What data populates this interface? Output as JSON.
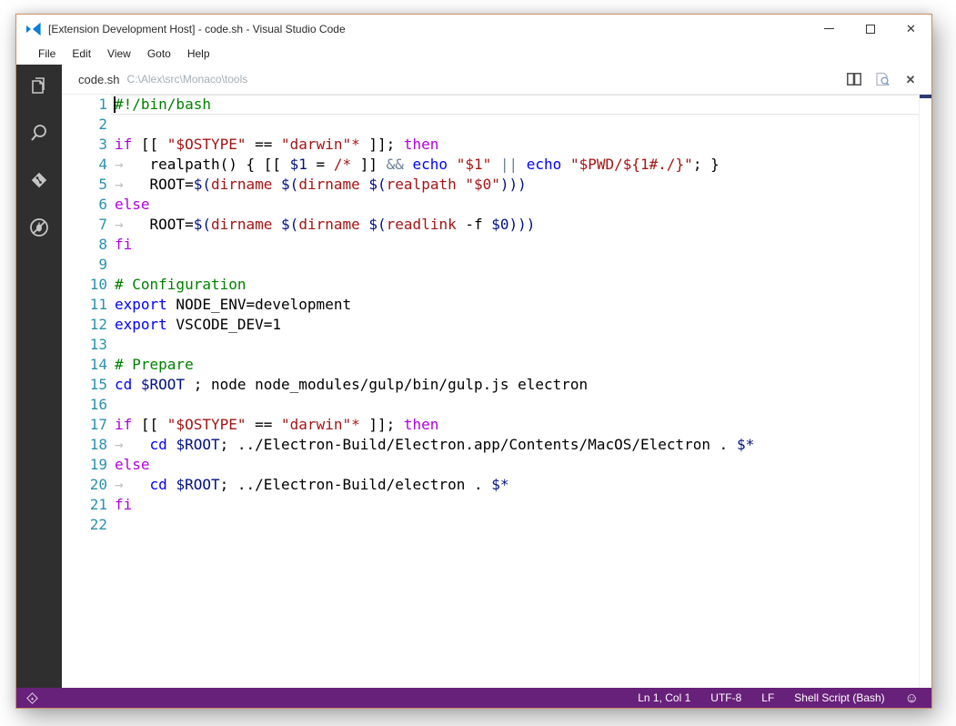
{
  "window": {
    "title": "[Extension Development Host] - code.sh - Visual Studio Code",
    "border_color": "#cb8f63",
    "controls": {
      "minimize": "minimize",
      "maximize": "maximize",
      "close": "close"
    }
  },
  "menu_bar": {
    "items": [
      {
        "label": "File",
        "name": "menu-item-file"
      },
      {
        "label": "Edit",
        "name": "menu-item-edit"
      },
      {
        "label": "View",
        "name": "menu-item-view"
      },
      {
        "label": "Goto",
        "name": "menu-item-goto"
      },
      {
        "label": "Help",
        "name": "menu-item-help"
      }
    ]
  },
  "activity_bar": {
    "icons": [
      "explorer",
      "search",
      "git",
      "debug"
    ],
    "background": "#2f2f2f"
  },
  "tab_bar": {
    "file_name": "code.sh",
    "file_path": "C:\\Alex\\src\\Monaco\\tools",
    "actions": [
      "split-editor",
      "preview",
      "close-tab"
    ]
  },
  "editor": {
    "cursor": {
      "line": 1,
      "col": 1
    },
    "token_colors": {
      "pl": "#000000",
      "kw": "#af00db",
      "bi": "#0000ff",
      "str": "#a31515",
      "fn": "#a31515",
      "var": "#001080",
      "op": "#6b8299",
      "cm": "#008000",
      "ws": "#c0c0c0"
    },
    "lines": [
      [
        {
          "t": "#!/bin/bash",
          "c": "cm"
        }
      ],
      [],
      [
        {
          "t": "if",
          "c": "kw"
        },
        {
          "t": " [[ ",
          "c": "pl"
        },
        {
          "t": "\"$OSTYPE\"",
          "c": "str"
        },
        {
          "t": " == ",
          "c": "pl"
        },
        {
          "t": "\"darwin\"*",
          "c": "str"
        },
        {
          "t": " ]]; ",
          "c": "pl"
        },
        {
          "t": "then",
          "c": "kw"
        }
      ],
      [
        {
          "t": "→   ",
          "c": "ws"
        },
        {
          "t": "realpath() { [[ ",
          "c": "pl"
        },
        {
          "t": "$1",
          "c": "var"
        },
        {
          "t": " = ",
          "c": "pl"
        },
        {
          "t": "/*",
          "c": "str"
        },
        {
          "t": " ]] ",
          "c": "pl"
        },
        {
          "t": "&&",
          "c": "op"
        },
        {
          "t": " ",
          "c": "pl"
        },
        {
          "t": "echo",
          "c": "bi"
        },
        {
          "t": " ",
          "c": "pl"
        },
        {
          "t": "\"$1\"",
          "c": "str"
        },
        {
          "t": " ",
          "c": "pl"
        },
        {
          "t": "||",
          "c": "op"
        },
        {
          "t": " ",
          "c": "pl"
        },
        {
          "t": "echo",
          "c": "bi"
        },
        {
          "t": " ",
          "c": "pl"
        },
        {
          "t": "\"$PWD/${1#./}\"",
          "c": "str"
        },
        {
          "t": "; }",
          "c": "pl"
        }
      ],
      [
        {
          "t": "→   ",
          "c": "ws"
        },
        {
          "t": "ROOT=",
          "c": "pl"
        },
        {
          "t": "$(",
          "c": "var"
        },
        {
          "t": "dirname",
          "c": "fn"
        },
        {
          "t": " ",
          "c": "pl"
        },
        {
          "t": "$(",
          "c": "var"
        },
        {
          "t": "dirname",
          "c": "fn"
        },
        {
          "t": " ",
          "c": "pl"
        },
        {
          "t": "$(",
          "c": "var"
        },
        {
          "t": "realpath",
          "c": "fn"
        },
        {
          "t": " ",
          "c": "pl"
        },
        {
          "t": "\"$0\"",
          "c": "str"
        },
        {
          "t": ")))",
          "c": "var"
        }
      ],
      [
        {
          "t": "else",
          "c": "kw"
        }
      ],
      [
        {
          "t": "→   ",
          "c": "ws"
        },
        {
          "t": "ROOT=",
          "c": "pl"
        },
        {
          "t": "$(",
          "c": "var"
        },
        {
          "t": "dirname",
          "c": "fn"
        },
        {
          "t": " ",
          "c": "pl"
        },
        {
          "t": "$(",
          "c": "var"
        },
        {
          "t": "dirname",
          "c": "fn"
        },
        {
          "t": " ",
          "c": "pl"
        },
        {
          "t": "$(",
          "c": "var"
        },
        {
          "t": "readlink",
          "c": "fn"
        },
        {
          "t": " -f ",
          "c": "pl"
        },
        {
          "t": "$0",
          "c": "var"
        },
        {
          "t": ")))",
          "c": "var"
        }
      ],
      [
        {
          "t": "fi",
          "c": "kw"
        }
      ],
      [],
      [
        {
          "t": "# Configuration",
          "c": "cm"
        }
      ],
      [
        {
          "t": "export",
          "c": "bi"
        },
        {
          "t": " NODE_ENV=development",
          "c": "pl"
        }
      ],
      [
        {
          "t": "export",
          "c": "bi"
        },
        {
          "t": " VSCODE_DEV=1",
          "c": "pl"
        }
      ],
      [],
      [
        {
          "t": "# Prepare",
          "c": "cm"
        }
      ],
      [
        {
          "t": "cd",
          "c": "bi"
        },
        {
          "t": " ",
          "c": "pl"
        },
        {
          "t": "$ROOT",
          "c": "var"
        },
        {
          "t": " ; node node_modules/gulp/bin/gulp.js electron",
          "c": "pl"
        }
      ],
      [],
      [
        {
          "t": "if",
          "c": "kw"
        },
        {
          "t": " [[ ",
          "c": "pl"
        },
        {
          "t": "\"$OSTYPE\"",
          "c": "str"
        },
        {
          "t": " == ",
          "c": "pl"
        },
        {
          "t": "\"darwin\"*",
          "c": "str"
        },
        {
          "t": " ]]; ",
          "c": "pl"
        },
        {
          "t": "then",
          "c": "kw"
        }
      ],
      [
        {
          "t": "→   ",
          "c": "ws"
        },
        {
          "t": "cd",
          "c": "bi"
        },
        {
          "t": " ",
          "c": "pl"
        },
        {
          "t": "$ROOT",
          "c": "var"
        },
        {
          "t": "; ../Electron-Build/Electron.app/Contents/MacOS/Electron . ",
          "c": "pl"
        },
        {
          "t": "$*",
          "c": "var"
        }
      ],
      [
        {
          "t": "else",
          "c": "kw"
        }
      ],
      [
        {
          "t": "→   ",
          "c": "ws"
        },
        {
          "t": "cd",
          "c": "bi"
        },
        {
          "t": " ",
          "c": "pl"
        },
        {
          "t": "$ROOT",
          "c": "var"
        },
        {
          "t": "; ../Electron-Build/electron . ",
          "c": "pl"
        },
        {
          "t": "$*",
          "c": "var"
        }
      ],
      [
        {
          "t": "fi",
          "c": "kw"
        }
      ],
      []
    ]
  },
  "status_bar": {
    "background": "#68217a",
    "right_items": [
      {
        "label": "Ln 1, Col 1",
        "name": "status-cursor-position"
      },
      {
        "label": "UTF-8",
        "name": "status-encoding"
      },
      {
        "label": "LF",
        "name": "status-eol"
      },
      {
        "label": "Shell Script (Bash)",
        "name": "status-language-mode"
      }
    ],
    "smiley": "☺"
  }
}
